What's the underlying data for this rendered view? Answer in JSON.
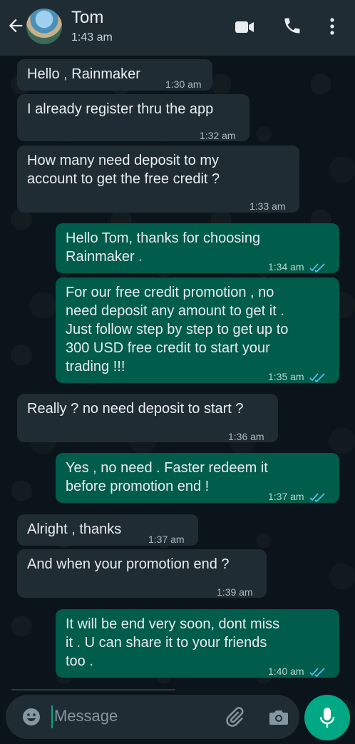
{
  "header": {
    "contact_name": "Tom",
    "status": "1:43 am",
    "icons": [
      "back-arrow-icon",
      "avatar",
      "video-call-icon",
      "phone-call-icon",
      "more-menu-icon"
    ]
  },
  "messages": [
    {
      "direction": "incoming",
      "text": "Hello , Rainmaker",
      "time": "1:30 am"
    },
    {
      "direction": "incoming",
      "text": "I already register thru the app",
      "time": "1:32 am"
    },
    {
      "direction": "incoming",
      "text": "How many need deposit to my\naccount to get the free credit ?",
      "time": "1:33 am"
    },
    {
      "direction": "outgoing",
      "text": "Hello Tom, thanks for choosing\nRainmaker .",
      "time": "1:34 am",
      "read": true
    },
    {
      "direction": "outgoing",
      "text": "For our free credit promotion , no\nneed deposit any amount to get it .\nJust follow step by step to get up to\n300 USD free credit to start your\ntrading !!!",
      "time": "1:35 am",
      "read": true
    },
    {
      "direction": "incoming",
      "text": "Really ? no need deposit to start ?",
      "time": "1:36 am"
    },
    {
      "direction": "outgoing",
      "text": "Yes , no need . Faster redeem it\nbefore promotion end !",
      "time": "1:37 am",
      "read": true
    },
    {
      "direction": "incoming",
      "text": "Alright , thanks",
      "time": "1:37 am"
    },
    {
      "direction": "incoming",
      "text": "And when your promotion end ?",
      "time": "1:39 am"
    },
    {
      "direction": "outgoing",
      "text": "It will be end very soon, dont miss\nit . U can share it to your friends\ntoo .",
      "time": "1:40 am",
      "read": true
    }
  ],
  "composer": {
    "placeholder": "Message",
    "icons": [
      "emoji-icon",
      "attach-icon",
      "camera-icon",
      "mic-icon"
    ]
  },
  "colors": {
    "background": "#0b141a",
    "header": "#1f2c34",
    "incoming_bubble": "#1f2c34",
    "outgoing_bubble": "#005c4b",
    "accent": "#00a884",
    "read_tick": "#53bdeb"
  }
}
